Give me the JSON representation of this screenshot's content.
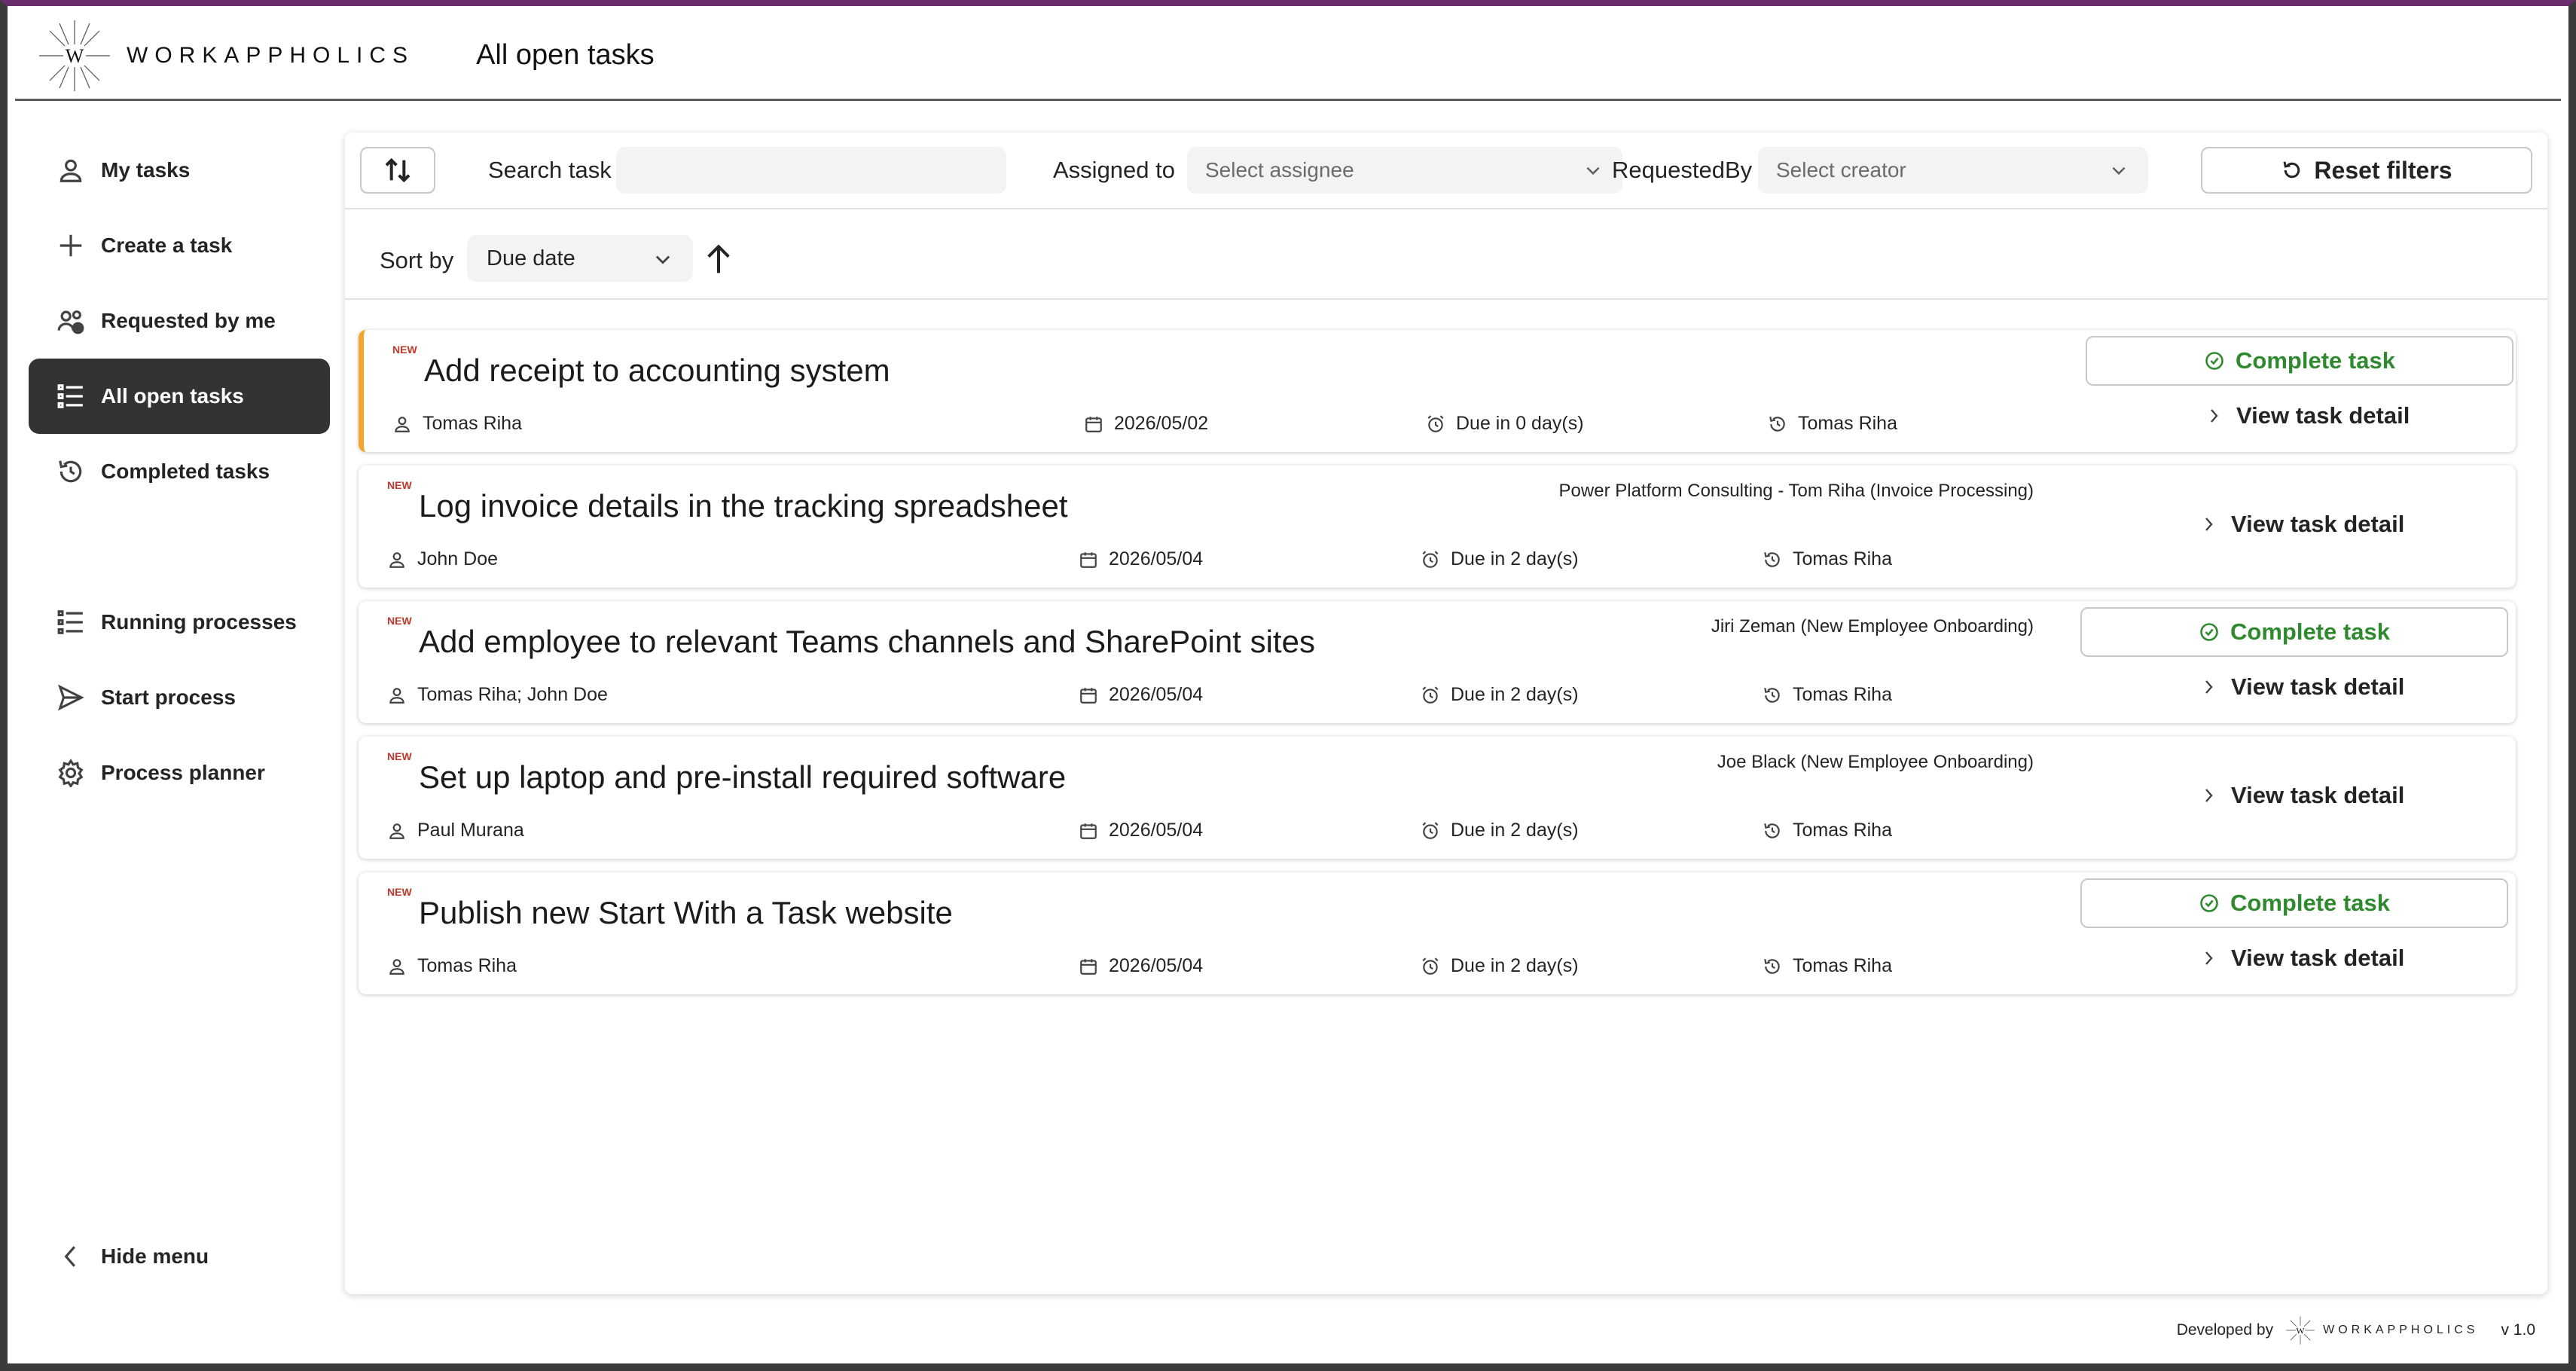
{
  "app": {
    "logo_letter": "W",
    "brand": "WORKAPPHOLICS",
    "page_title": "All open tasks"
  },
  "sidebar": {
    "items": [
      {
        "label": "My tasks",
        "icon": "person-icon"
      },
      {
        "label": "Create a task",
        "icon": "plus-icon"
      },
      {
        "label": "Requested by me",
        "icon": "people-icon"
      },
      {
        "label": "All open tasks",
        "icon": "list-icon",
        "active": true
      },
      {
        "label": "Completed tasks",
        "icon": "history-icon"
      },
      {
        "label": "Running processes",
        "icon": "list-icon"
      },
      {
        "label": "Start process",
        "icon": "send-icon"
      },
      {
        "label": "Process planner",
        "icon": "gear-icon"
      }
    ],
    "hide_menu": "Hide menu"
  },
  "filters": {
    "search_label": "Search task",
    "search_value": "",
    "assigned_label": "Assigned to",
    "assigned_placeholder": "Select assignee",
    "requested_label": "RequestedBy",
    "requested_placeholder": "Select creator",
    "reset_label": "Reset filters"
  },
  "sort": {
    "label": "Sort by",
    "value": "Due date",
    "direction": "ascending"
  },
  "tasks": [
    {
      "badge": "NEW",
      "title": "Add receipt to accounting system",
      "source": "",
      "assignee": "Tomas Riha",
      "date": "2026/05/02",
      "due": "Due in 0 day(s)",
      "requested_by": "Tomas Riha",
      "can_complete": true,
      "complete_label": "Complete task",
      "detail_label": "View task detail"
    },
    {
      "badge": "NEW",
      "title": "Log invoice details in the tracking spreadsheet",
      "source": "Power Platform Consulting - Tom Riha (Invoice Processing)",
      "assignee": "John Doe",
      "date": "2026/05/04",
      "due": "Due in 2 day(s)",
      "requested_by": "Tomas Riha",
      "can_complete": false,
      "complete_label": "",
      "detail_label": "View task detail"
    },
    {
      "badge": "NEW",
      "title": "Add employee to relevant Teams channels and SharePoint sites",
      "source": "Jiri Zeman (New Employee Onboarding)",
      "assignee": "Tomas Riha; John Doe",
      "date": "2026/05/04",
      "due": "Due in 2 day(s)",
      "requested_by": "Tomas Riha",
      "can_complete": true,
      "complete_label": "Complete task",
      "detail_label": "View task detail"
    },
    {
      "badge": "NEW",
      "title": "Set up laptop and pre-install required software",
      "source": "Joe Black (New Employee Onboarding)",
      "assignee": "Paul Murana",
      "date": "2026/05/04",
      "due": "Due in 2 day(s)",
      "requested_by": "Tomas Riha",
      "can_complete": false,
      "complete_label": "",
      "detail_label": "View task detail"
    },
    {
      "badge": "NEW",
      "title": "Publish new Start With a Task website",
      "source": "",
      "assignee": "Tomas Riha",
      "date": "2026/05/04",
      "due": "Due in 2 day(s)",
      "requested_by": "Tomas Riha",
      "can_complete": true,
      "complete_label": "Complete task",
      "detail_label": "View task detail"
    }
  ],
  "footer": {
    "developed_by": "Developed by",
    "brand": "WORKAPPHOLICS",
    "logo_letter": "W",
    "version": "v 1.0"
  },
  "colors": {
    "top_border": "#6b2d6e",
    "active_nav": "#333333",
    "complete_green": "#2f8a2f",
    "highlight_bar": "#f2a72b",
    "new_badge": "#c0392b"
  }
}
